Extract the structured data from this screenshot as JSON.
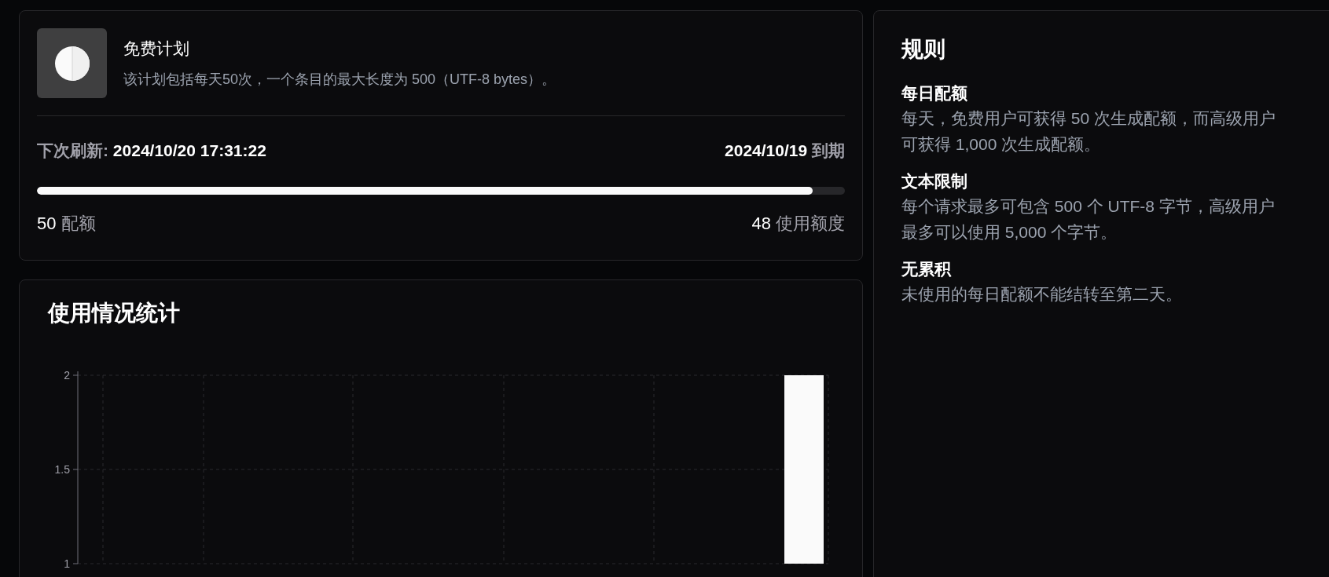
{
  "plan": {
    "title": "免费计划",
    "description": "该计划包括每天50次，一个条目的最大长度为 500（UTF-8 bytes）。",
    "refresh_label": "下次刷新:",
    "refresh_time": "2024/10/20 17:31:22",
    "expiry_date": "2024/10/19",
    "expiry_label": "到期",
    "usage": {
      "level": 0.96
    },
    "quota_value": "50",
    "quota_label": "配额",
    "used_value": "48",
    "used_label": "使用额度"
  },
  "usage_stats": {
    "title": "使用情况统计",
    "chart_data": {
      "type": "bar",
      "values": [
        2
      ],
      "yticks": [
        1,
        1.5,
        2
      ],
      "ylim": [
        1,
        2
      ]
    }
  },
  "rules": {
    "title": "规则",
    "items": [
      {
        "heading": "每日配额",
        "body": "每天，免费用户可获得 50 次生成配额，而高级用户可获得 1,000 次生成配额。"
      },
      {
        "heading": "文本限制",
        "body": "每个请求最多可包含 500 个 UTF-8 字节，高级用户最多可以使用 5,000 个字节。"
      },
      {
        "heading": "无累积",
        "body": "未使用的每日配额不能结转至第二天。"
      }
    ]
  }
}
